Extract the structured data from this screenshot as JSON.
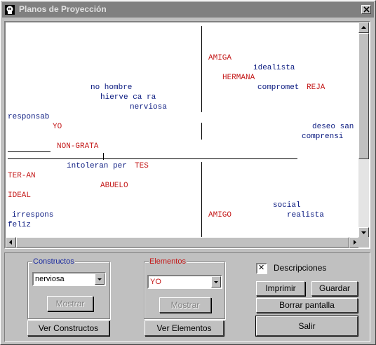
{
  "window": {
    "title": "Planos de Proyección",
    "close_label": "✕"
  },
  "plot": {
    "labels": [
      {
        "text": "AMIGA",
        "kind": "elemento"
      },
      {
        "text": "idealista",
        "kind": "constructo"
      },
      {
        "text": "HERMANA",
        "kind": "elemento"
      },
      {
        "text": "no hombre",
        "kind": "constructo"
      },
      {
        "text": "compromet",
        "kind": "constructo"
      },
      {
        "text": "REJA",
        "kind": "elemento"
      },
      {
        "text": "hierve ca ra",
        "kind": "constructo"
      },
      {
        "text": "nerviosa",
        "kind": "constructo"
      },
      {
        "text": "responsab",
        "kind": "constructo"
      },
      {
        "text": "YO",
        "kind": "elemento"
      },
      {
        "text": "deseo san",
        "kind": "constructo"
      },
      {
        "text": "comprensi",
        "kind": "constructo"
      },
      {
        "text": "NON-GRATA",
        "kind": "elemento"
      },
      {
        "text": "intoleran per",
        "kind": "constructo"
      },
      {
        "text": "TES",
        "kind": "elemento"
      },
      {
        "text": "TER-AN",
        "kind": "elemento"
      },
      {
        "text": "ABUELO",
        "kind": "elemento"
      },
      {
        "text": "IDEAL",
        "kind": "elemento"
      },
      {
        "text": "social",
        "kind": "constructo"
      },
      {
        "text": "irrespons",
        "kind": "constructo"
      },
      {
        "text": "AMIGO",
        "kind": "elemento"
      },
      {
        "text": "realista",
        "kind": "constructo"
      },
      {
        "text": "feliz",
        "kind": "constructo"
      }
    ],
    "colors": {
      "constructo": "#0a1a80",
      "elemento": "#c41a1a"
    }
  },
  "constructos": {
    "title": "Constructos",
    "selected": "nerviosa",
    "mostrar": "Mostrar",
    "ver": "Ver Constructos"
  },
  "elementos": {
    "title": "Elementos",
    "selected": "YO",
    "mostrar": "Mostrar",
    "ver": "Ver Elementos"
  },
  "descripciones": {
    "label": "Descripciones",
    "checked": true,
    "mark": "✕"
  },
  "buttons": {
    "imprimir": "Imprimir",
    "guardar": "Guardar",
    "borrar": "Borrar pantalla",
    "salir": "Salir"
  }
}
